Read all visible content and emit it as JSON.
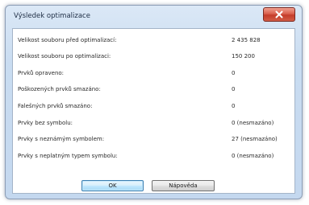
{
  "dialog": {
    "title": "Výsledek optimalizace"
  },
  "stats": [
    {
      "label": "Velikost souboru před optimalizací:",
      "value": "2 435 828"
    },
    {
      "label": "Velikost souboru po optimalizaci:",
      "value": "150 200"
    },
    {
      "label": "Prvků opraveno:",
      "value": "0"
    },
    {
      "label": "Poškozených prvků smazáno:",
      "value": "0"
    },
    {
      "label": "Falešných prvků smazáno:",
      "value": "0"
    },
    {
      "label": "Prvky bez symbolu:",
      "value": "0 (nesmazáno)"
    },
    {
      "label": "Prvky s neznámým symbolem:",
      "value": "27 (nesmazáno)"
    },
    {
      "label": "Prvky s neplatným typem symbolu:",
      "value": "0 (nesmazáno)"
    }
  ],
  "buttons": {
    "ok_label": "OK",
    "help_label": "Nápověda"
  },
  "colors": {
    "frame": "#c4d8ef",
    "close_button": "#c43c2a",
    "default_button_border": "#3c7fb1"
  },
  "icons": {
    "close": "close-icon"
  }
}
